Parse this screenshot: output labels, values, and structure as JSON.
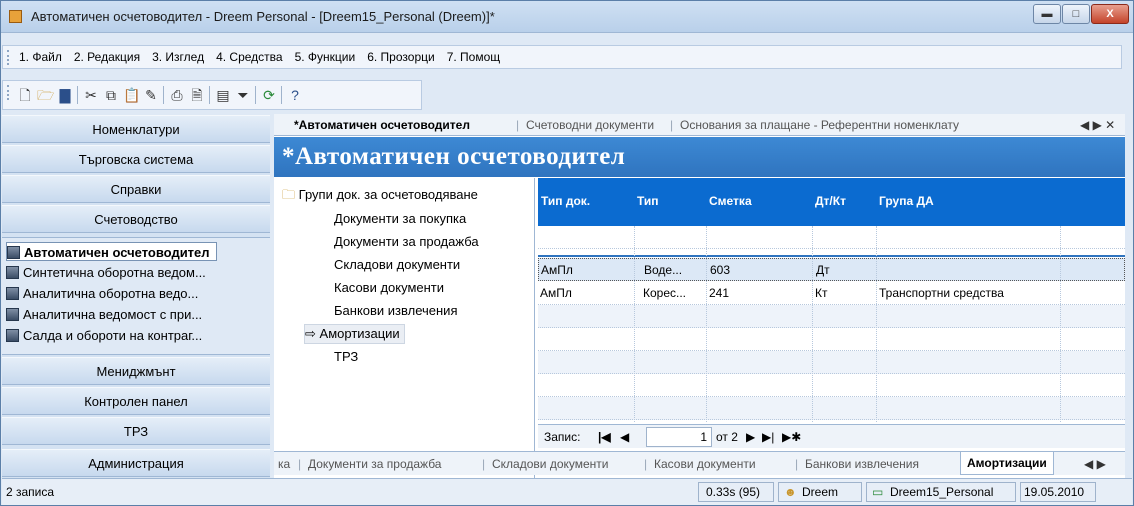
{
  "window": {
    "title": "Автоматичен осчетоводител - Dreem Personal - [Dreem15_Personal (Dreem)]*",
    "buttons": {
      "minimize": "▬",
      "maximize": "□",
      "close": "X"
    }
  },
  "menu": {
    "items": [
      "1. Файл",
      "2. Редакция",
      "3. Изглед",
      "4. Средства",
      "5. Функции",
      "6. Прозорци",
      "7. Помощ"
    ]
  },
  "toolbar": {
    "icons": [
      "new-icon",
      "open-icon",
      "save-icon",
      "cut-icon",
      "copy-icon",
      "paste-icon",
      "edit-icon",
      "print-icon",
      "preview-icon",
      "window-icon",
      "filter-icon",
      "refresh-icon",
      "help-icon"
    ]
  },
  "sidebar": {
    "sections_top": [
      "Номенклатури",
      "Търговска система",
      "Справки",
      "Счетоводство"
    ],
    "items": [
      "Автоматичен осчетоводител",
      "Синтетична оборотна ведом...",
      "Аналитична оборотна ведо...",
      "Аналитична ведомост с при...",
      "Салда и обороти на контраг..."
    ],
    "sections_bottom": [
      "Мениджмънт",
      "Контролен панел",
      "ТРЗ",
      "Администрация"
    ]
  },
  "tabs_top": {
    "active": "*Автоматичен осчетоводител",
    "tab2": "Счетоводни документи",
    "tab3": "Основания за плащане - Референтни номенклату",
    "nav": "◀ ▶ ✕"
  },
  "banner": "*Автоматичен осчетоводител",
  "tree": {
    "root": "Групи док. за осчетоводяване",
    "children": [
      "Документи за покупка",
      "Документи за продажба",
      "Складови документи",
      "Касови документи",
      "Банкови извлечения",
      "Амортизации",
      "ТРЗ"
    ]
  },
  "grid": {
    "headers": [
      "Тип док.",
      "Тип",
      "Сметка",
      "Дт/Кт",
      "Група ДА"
    ],
    "rows": [
      [
        "АмПл",
        "Воде...",
        "603",
        "Дт",
        ""
      ],
      [
        "АмПл",
        "Корес...",
        "241",
        "Кт",
        "Транспортни средства"
      ]
    ],
    "record_label": "Запис:",
    "record_current": "1",
    "record_total": "от 2"
  },
  "tabs_bottom": {
    "t0": "ка",
    "t1": "Документи за продажба",
    "t2": "Складови документи",
    "t3": "Касови документи",
    "t4": "Банкови извлечения",
    "active": "Амортизации",
    "nav": "◀ ▶"
  },
  "status": {
    "records": "2 записа",
    "timing": "0.33s (95)",
    "user": "Dreem",
    "database": "Dreem15_Personal",
    "date": "19.05.2010"
  }
}
